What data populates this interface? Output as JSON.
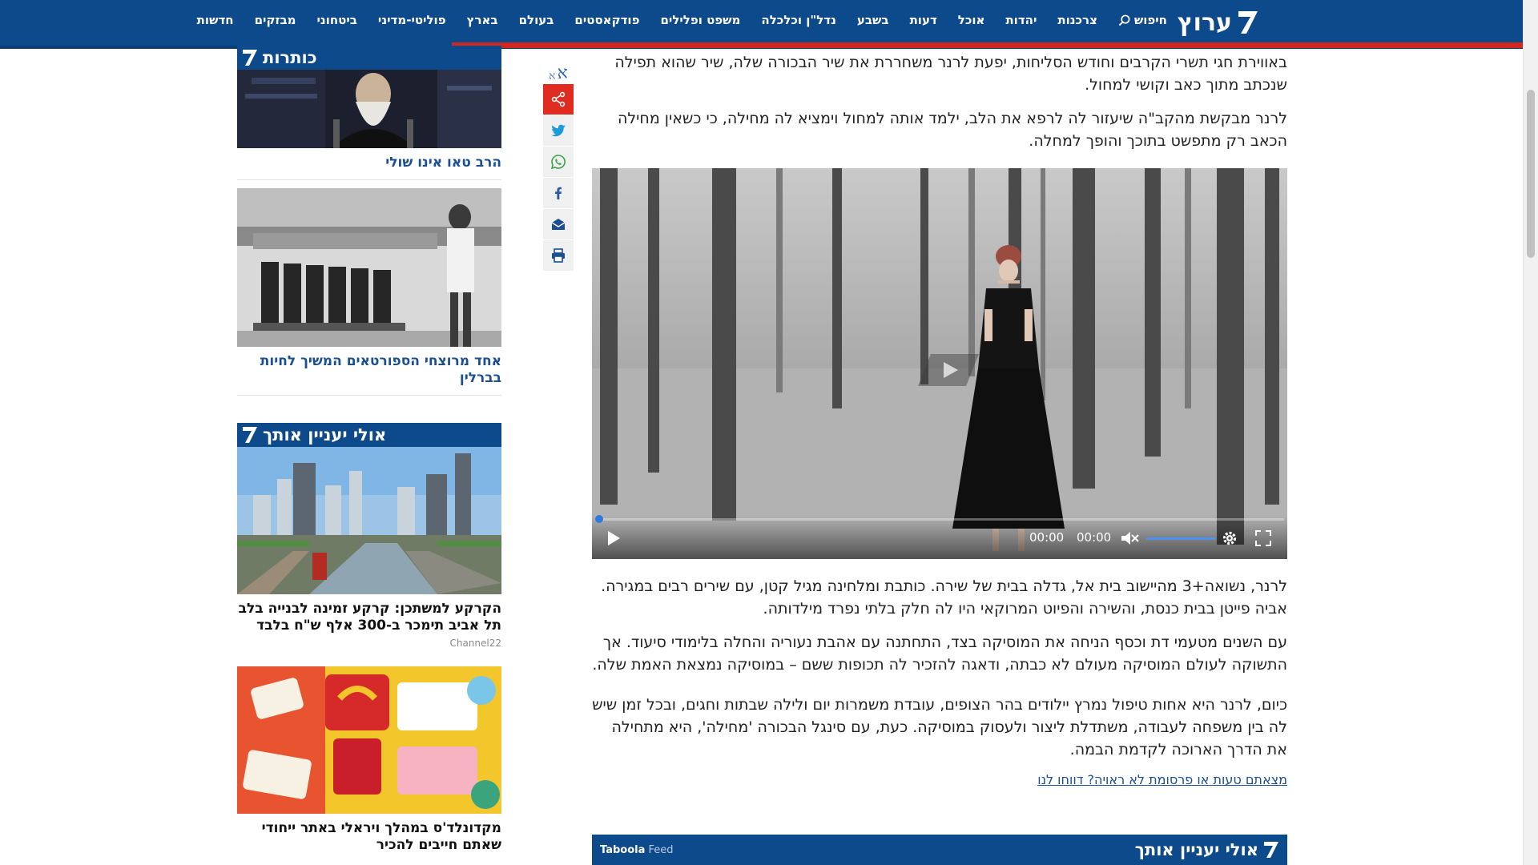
{
  "header": {
    "logo_text": "ערוץ",
    "nav": [
      "חדשות",
      "מבזקים",
      "ביטחוני",
      "פוליטי-מדיני",
      "בארץ",
      "בעולם",
      "פודקאסטים",
      "משפט ופלילים",
      "נדל\"ן וכלכלה",
      "בשבע",
      "דעות",
      "אוכל",
      "יהדות",
      "צרכנות"
    ],
    "search_label": "חיפוש"
  },
  "sidebar": {
    "headlines_title": "כותרות",
    "headline_cards": [
      {
        "title": "הרב טאו אינו שולי"
      },
      {
        "title": "אחד מרוצחי הספורטאים המשיך לחיות בברלין"
      }
    ],
    "recommend_title": "אולי יעניין אותך",
    "promo_cards": [
      {
        "title": "הקרקע למשתכן: קרקע זמינה לבנייה בלב תל אביב תימכר ב-300 אלף ש\"ח בלבד",
        "source": "Channel22"
      },
      {
        "title": "מקדונלד'ס במהלך ויראלי באתר ייחודי שאתם חייבים להכיר"
      }
    ]
  },
  "share": {
    "font_big": "א",
    "font_small": "א"
  },
  "article": {
    "paragraphs_top": [
      "באווירת חגי תשרי הקרבים וחודש הסליחות, יפעת לרנר משחררת את שיר הבכורה שלה, שיר שהוא תפילה שנכתב מתוך כאב וקושי למחול.",
      "לרנר מבקשת מהקב\"ה שיעזור לה לרפא את הלב, ילמד אותה למחול וימציא לה מחילה, כי כשאין מחילה הכאב רק מתפשט בתוכך והופך למחלה."
    ],
    "video": {
      "current_time": "00:00",
      "duration": "00:00",
      "progress": 0
    },
    "paragraphs_bottom": [
      "לרנר, נשואה+3 מהיישוב בית אל, גדלה בבית של שירה. כותבת ומלחינה מגיל קטן, עם שירים רבים במגירה. אביה פייטן בבית כנסת, והשירה והפיוט המרוקאי היו לה חלק בלתי נפרד מילדותה.",
      "עם השנים מטעמי דת וכסף הניחה את המוסיקה בצד, התחתנה עם אהבת נעוריה והחלה בלימודי סיעוד. אך התשוקה לעולם המוסיקה מעולם לא כבתה, ודאגה להזכיר לה תכופות ששם – במוסיקה נמצאת האמת שלה.",
      "כיום, לרנר היא אחות טיפול נמרץ יילודים בהר הצופים, עובדת משמרות יום ולילה שבתות וחגים, ובכל זמן שיש לה בין משפחה לעבודה, משתדלת ליצור ולעסוק במוסיקה. כעת, עם סינגל הבכורה 'מחילה', היא מתחילה את הדרך הארוכה לקדמת הבמה."
    ],
    "report_link": "מצאתם טעות או פרסומת לא ראויה? דווחו לנו"
  },
  "taboola": {
    "title": "אולי יעניין אותך",
    "brand_main": "Taboola",
    "brand_feed": "Feed"
  },
  "colors": {
    "brand_blue": "#0c4a8b",
    "accent_red": "#d0281f",
    "link_blue": "#1a4f93"
  }
}
